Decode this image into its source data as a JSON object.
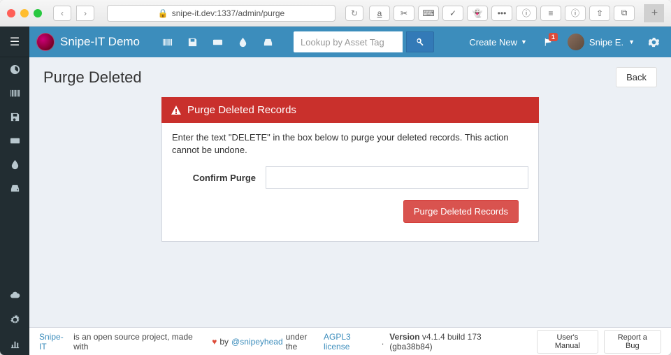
{
  "browser": {
    "url": "snipe-it.dev:1337/admin/purge"
  },
  "app": {
    "title": "Snipe-IT Demo"
  },
  "topbar": {
    "search_placeholder": "Lookup by Asset Tag",
    "create_label": "Create New",
    "notification_count": "1",
    "user_name": "Snipe E."
  },
  "page": {
    "title": "Purge Deleted",
    "back": "Back"
  },
  "panel": {
    "heading": "Purge Deleted Records",
    "instructions": "Enter the text \"DELETE\" in the box below to purge your deleted records. This action cannot be undone.",
    "confirm_label": "Confirm Purge",
    "submit": "Purge Deleted Records"
  },
  "footer": {
    "link1": "Snipe-IT",
    "text1": " is an open source project, made with ",
    "text2": " by ",
    "author": "@snipeyhead",
    "text3": " under the ",
    "license": "AGPL3 license",
    "version_label": "Version",
    "version": " v4.1.4 build 173 (gba38b84)",
    "manual": "User's Manual",
    "bug": "Report a Bug"
  }
}
